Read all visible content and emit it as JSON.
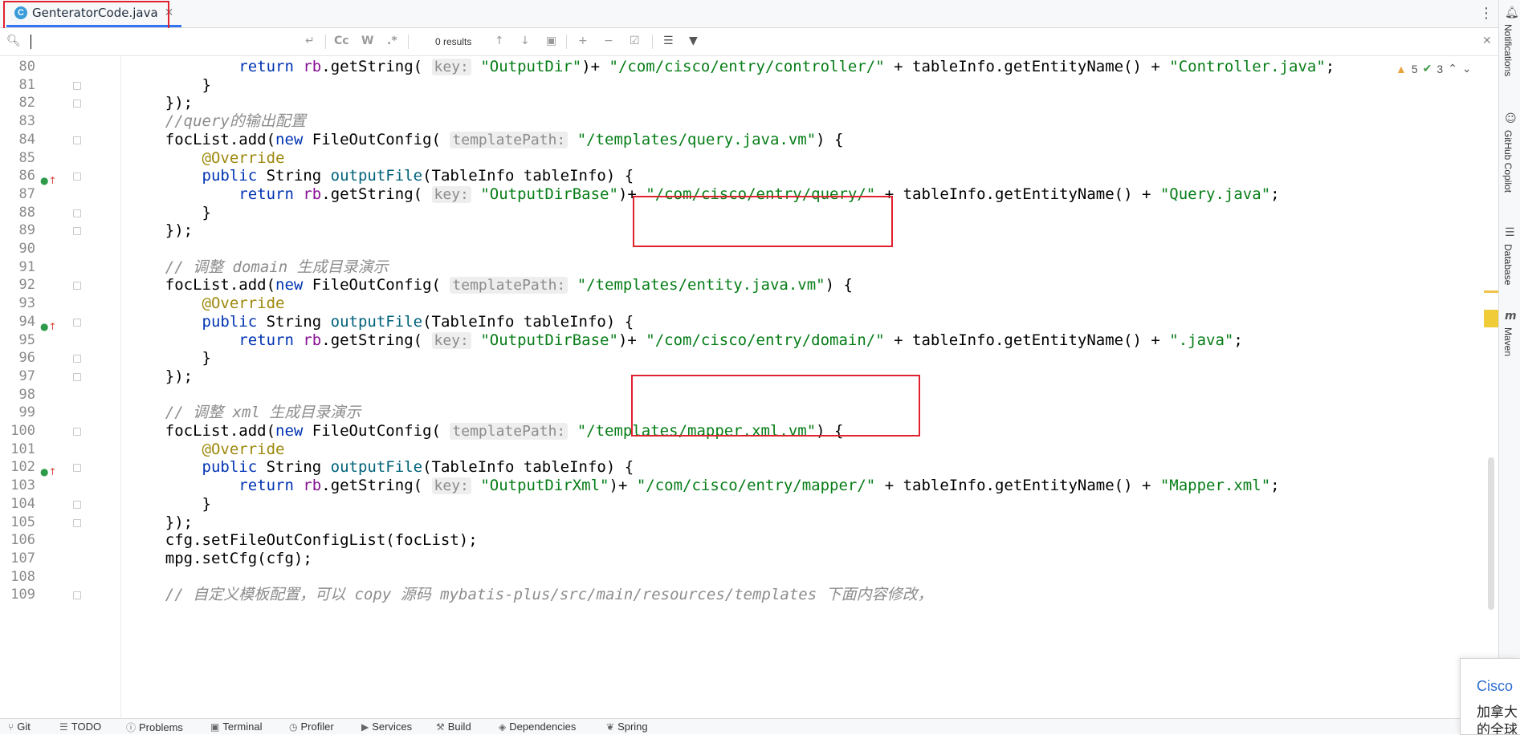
{
  "tab": {
    "icon": "C",
    "label": "GenteratorCode.java"
  },
  "find": {
    "value": "",
    "results": "0 results",
    "case_label": "Cc",
    "word_label": "W",
    "regex_label": ".*"
  },
  "inspections": {
    "warnings": "5",
    "checks": "3"
  },
  "lines": [
    {
      "n": "80",
      "mark": false,
      "fold": false,
      "segments": [
        {
          "c": "",
          "t": "            "
        },
        {
          "c": "kw",
          "t": "return "
        },
        {
          "c": "fl",
          "t": "rb"
        },
        {
          "c": "",
          "t": ".getString( "
        },
        {
          "c": "hint",
          "t": "key:"
        },
        {
          "c": "",
          "t": " "
        },
        {
          "c": "str",
          "t": "\"OutputDir\""
        },
        {
          "c": "",
          "t": ")+ "
        },
        {
          "c": "str",
          "t": "\"/com/cisco/entry/controller/\""
        },
        {
          "c": "",
          "t": " + tableInfo.getEntityName() + "
        },
        {
          "c": "str",
          "t": "\"Controller.java\""
        },
        {
          "c": "",
          "t": ";"
        }
      ]
    },
    {
      "n": "81",
      "mark": false,
      "fold": true,
      "segments": [
        {
          "c": "",
          "t": "        }"
        }
      ]
    },
    {
      "n": "82",
      "mark": false,
      "fold": true,
      "segments": [
        {
          "c": "",
          "t": "    });"
        }
      ]
    },
    {
      "n": "83",
      "mark": false,
      "fold": false,
      "segments": [
        {
          "c": "cm",
          "t": "    //query的输出配置"
        }
      ]
    },
    {
      "n": "84",
      "mark": false,
      "fold": true,
      "segments": [
        {
          "c": "",
          "t": "    focList.add("
        },
        {
          "c": "kw",
          "t": "new "
        },
        {
          "c": "",
          "t": "FileOutConfig( "
        },
        {
          "c": "hint",
          "t": "templatePath:"
        },
        {
          "c": "",
          "t": " "
        },
        {
          "c": "str",
          "t": "\"/templates/query.java.vm\""
        },
        {
          "c": "",
          "t": ") {"
        }
      ]
    },
    {
      "n": "85",
      "mark": false,
      "fold": false,
      "segments": [
        {
          "c": "an",
          "t": "        @Override"
        }
      ]
    },
    {
      "n": "86",
      "mark": true,
      "fold": true,
      "segments": [
        {
          "c": "",
          "t": "        "
        },
        {
          "c": "kw",
          "t": "public "
        },
        {
          "c": "",
          "t": "String "
        },
        {
          "c": "mt",
          "t": "outputFile"
        },
        {
          "c": "",
          "t": "(TableInfo tableInfo) {"
        }
      ]
    },
    {
      "n": "87",
      "mark": false,
      "fold": false,
      "segments": [
        {
          "c": "",
          "t": "            "
        },
        {
          "c": "kw",
          "t": "return "
        },
        {
          "c": "fl",
          "t": "rb"
        },
        {
          "c": "",
          "t": ".getString( "
        },
        {
          "c": "hint",
          "t": "key:"
        },
        {
          "c": "",
          "t": " "
        },
        {
          "c": "str",
          "t": "\"OutputDirBase\""
        },
        {
          "c": "",
          "t": ")+ "
        },
        {
          "c": "str",
          "t": "\"/com/cisco/entry/query/\""
        },
        {
          "c": "",
          "t": " + tableInfo.getEntityName() + "
        },
        {
          "c": "str",
          "t": "\"Query.java\""
        },
        {
          "c": "",
          "t": ";"
        }
      ]
    },
    {
      "n": "88",
      "mark": false,
      "fold": true,
      "segments": [
        {
          "c": "",
          "t": "        }"
        }
      ]
    },
    {
      "n": "89",
      "mark": false,
      "fold": true,
      "segments": [
        {
          "c": "",
          "t": "    });"
        }
      ]
    },
    {
      "n": "90",
      "mark": false,
      "fold": false,
      "segments": [
        {
          "c": "",
          "t": ""
        }
      ]
    },
    {
      "n": "91",
      "mark": false,
      "fold": false,
      "segments": [
        {
          "c": "cm",
          "t": "    // 调整 domain 生成目录演示"
        }
      ]
    },
    {
      "n": "92",
      "mark": false,
      "fold": true,
      "segments": [
        {
          "c": "",
          "t": "    focList.add("
        },
        {
          "c": "kw",
          "t": "new "
        },
        {
          "c": "",
          "t": "FileOutConfig( "
        },
        {
          "c": "hint",
          "t": "templatePath:"
        },
        {
          "c": "",
          "t": " "
        },
        {
          "c": "str",
          "t": "\"/templates/entity.java.vm\""
        },
        {
          "c": "",
          "t": ") {"
        }
      ]
    },
    {
      "n": "93",
      "mark": false,
      "fold": false,
      "segments": [
        {
          "c": "an",
          "t": "        @Override"
        }
      ]
    },
    {
      "n": "94",
      "mark": true,
      "fold": true,
      "segments": [
        {
          "c": "",
          "t": "        "
        },
        {
          "c": "kw",
          "t": "public "
        },
        {
          "c": "",
          "t": "String "
        },
        {
          "c": "mt",
          "t": "outputFile"
        },
        {
          "c": "",
          "t": "(TableInfo tableInfo) {"
        }
      ]
    },
    {
      "n": "95",
      "mark": false,
      "fold": false,
      "segments": [
        {
          "c": "",
          "t": "            "
        },
        {
          "c": "kw",
          "t": "return "
        },
        {
          "c": "fl",
          "t": "rb"
        },
        {
          "c": "",
          "t": ".getString( "
        },
        {
          "c": "hint",
          "t": "key:"
        },
        {
          "c": "",
          "t": " "
        },
        {
          "c": "str",
          "t": "\"OutputDirBase\""
        },
        {
          "c": "",
          "t": ")+ "
        },
        {
          "c": "str",
          "t": "\"/com/cisco/entry/domain/\""
        },
        {
          "c": "",
          "t": " + tableInfo.getEntityName() + "
        },
        {
          "c": "str",
          "t": "\".java\""
        },
        {
          "c": "",
          "t": ";"
        }
      ]
    },
    {
      "n": "96",
      "mark": false,
      "fold": true,
      "segments": [
        {
          "c": "",
          "t": "        }"
        }
      ]
    },
    {
      "n": "97",
      "mark": false,
      "fold": true,
      "segments": [
        {
          "c": "",
          "t": "    });"
        }
      ]
    },
    {
      "n": "98",
      "mark": false,
      "fold": false,
      "segments": [
        {
          "c": "",
          "t": ""
        }
      ]
    },
    {
      "n": "99",
      "mark": false,
      "fold": false,
      "segments": [
        {
          "c": "cm",
          "t": "    // 调整 xml 生成目录演示"
        }
      ]
    },
    {
      "n": "100",
      "mark": false,
      "fold": true,
      "segments": [
        {
          "c": "",
          "t": "    focList.add("
        },
        {
          "c": "kw",
          "t": "new "
        },
        {
          "c": "",
          "t": "FileOutConfig( "
        },
        {
          "c": "hint",
          "t": "templatePath:"
        },
        {
          "c": "",
          "t": " "
        },
        {
          "c": "str",
          "t": "\"/templates/mapper.xml.vm\""
        },
        {
          "c": "",
          "t": ") {"
        }
      ]
    },
    {
      "n": "101",
      "mark": false,
      "fold": false,
      "segments": [
        {
          "c": "an",
          "t": "        @Override"
        }
      ]
    },
    {
      "n": "102",
      "mark": true,
      "fold": true,
      "segments": [
        {
          "c": "",
          "t": "        "
        },
        {
          "c": "kw",
          "t": "public "
        },
        {
          "c": "",
          "t": "String "
        },
        {
          "c": "mt",
          "t": "outputFile"
        },
        {
          "c": "",
          "t": "(TableInfo tableInfo) {"
        }
      ]
    },
    {
      "n": "103",
      "mark": false,
      "fold": false,
      "segments": [
        {
          "c": "",
          "t": "            "
        },
        {
          "c": "kw",
          "t": "return "
        },
        {
          "c": "fl",
          "t": "rb"
        },
        {
          "c": "",
          "t": ".getString( "
        },
        {
          "c": "hint",
          "t": "key:"
        },
        {
          "c": "",
          "t": " "
        },
        {
          "c": "str",
          "t": "\"OutputDirXml\""
        },
        {
          "c": "",
          "t": ")+ "
        },
        {
          "c": "str",
          "t": "\"/com/cisco/entry/mapper/\""
        },
        {
          "c": "",
          "t": " + tableInfo.getEntityName() + "
        },
        {
          "c": "str",
          "t": "\"Mapper.xml\""
        },
        {
          "c": "",
          "t": ";"
        }
      ]
    },
    {
      "n": "104",
      "mark": false,
      "fold": true,
      "segments": [
        {
          "c": "",
          "t": "        }"
        }
      ]
    },
    {
      "n": "105",
      "mark": false,
      "fold": true,
      "segments": [
        {
          "c": "",
          "t": "    });"
        }
      ]
    },
    {
      "n": "106",
      "mark": false,
      "fold": false,
      "segments": [
        {
          "c": "",
          "t": "    cfg.setFileOutConfigList(focList);"
        }
      ]
    },
    {
      "n": "107",
      "mark": false,
      "fold": false,
      "segments": [
        {
          "c": "",
          "t": "    mpg.setCfg(cfg);"
        }
      ]
    },
    {
      "n": "108",
      "mark": false,
      "fold": false,
      "segments": [
        {
          "c": "",
          "t": ""
        }
      ]
    },
    {
      "n": "109",
      "mark": false,
      "fold": true,
      "segments": [
        {
          "c": "cm",
          "t": "    // 自定义模板配置，可以 copy 源码 mybatis-plus/src/main/resources/templates 下面内容修改，"
        }
      ]
    }
  ],
  "right_tools": [
    "Notifications",
    "GitHub Copilot",
    "Database",
    "Maven"
  ],
  "status": [
    "Git",
    "TODO",
    "Problems",
    "Terminal",
    "Profiler",
    "Services",
    "Build",
    "Dependencies",
    "Spring"
  ],
  "popup": {
    "title": "Cisco",
    "line1": "加拿大",
    "line2": "的全球"
  },
  "colors": {
    "accent": "#3574f0",
    "annotation": "#e0212e",
    "keyword": "#0033b3",
    "string": "#067d17",
    "comment": "#8c8c8c",
    "annotation_code": "#9e880d"
  }
}
